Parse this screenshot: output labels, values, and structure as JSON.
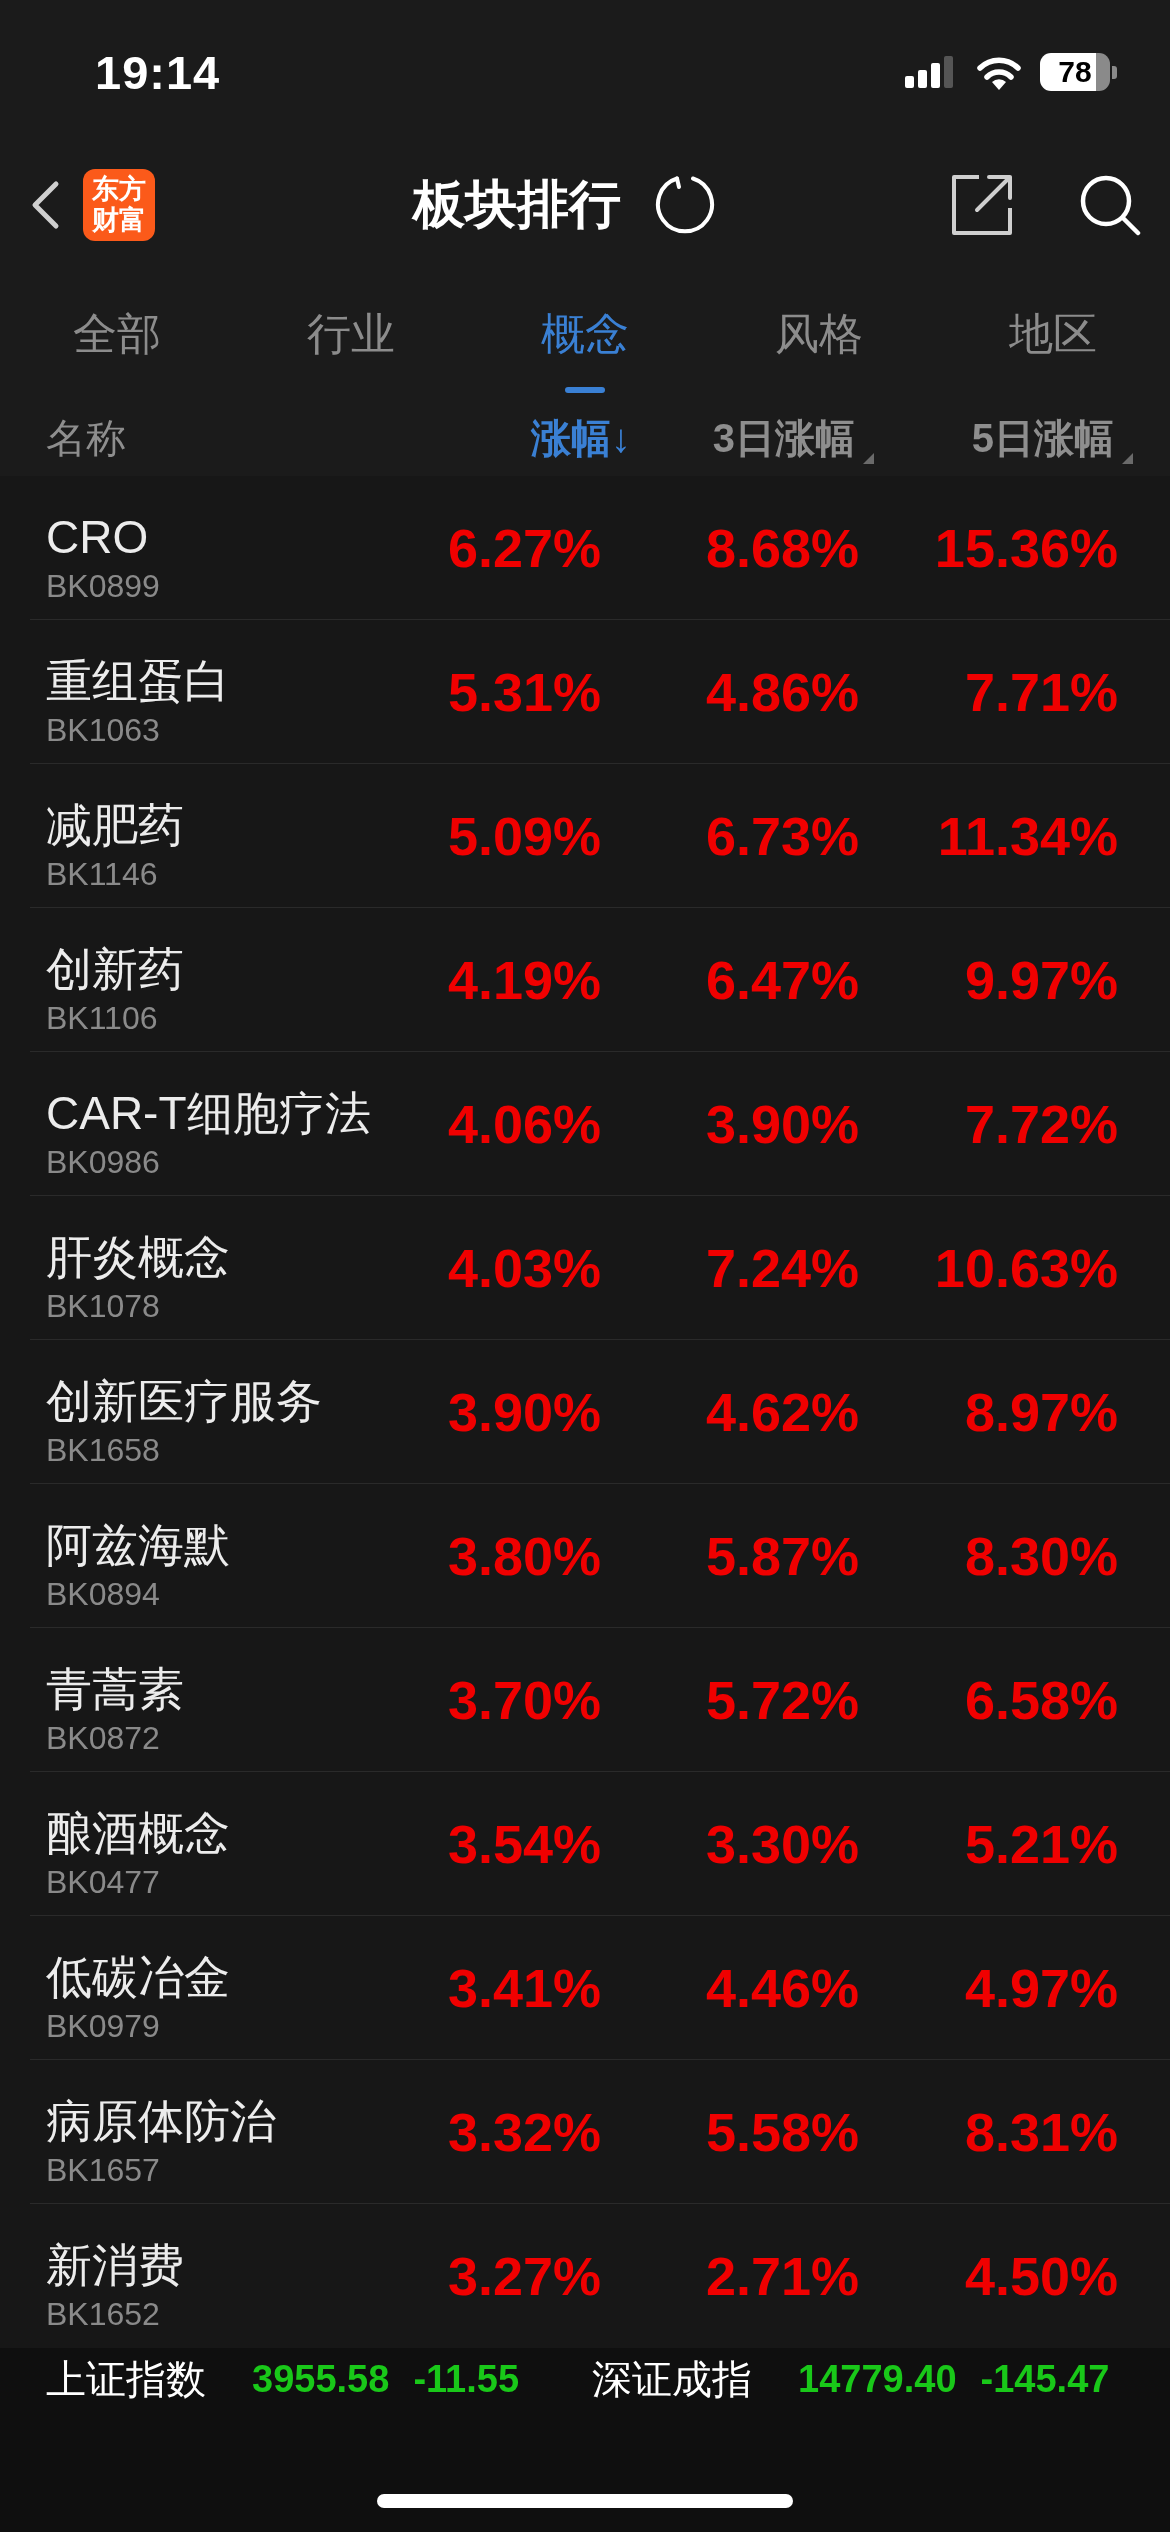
{
  "status_bar": {
    "time": "19:14",
    "battery": "78"
  },
  "header": {
    "logo": [
      "东方",
      "财富"
    ],
    "title": "板块排行"
  },
  "tabs": [
    {
      "label": "全部",
      "selected": false
    },
    {
      "label": "行业",
      "selected": false
    },
    {
      "label": "概念",
      "selected": true
    },
    {
      "label": "风格",
      "selected": false
    },
    {
      "label": "地区",
      "selected": false
    }
  ],
  "table": {
    "name_header": "名称",
    "sort_columns": [
      {
        "label": "涨幅↓",
        "selected": true
      },
      {
        "label": "3日涨幅",
        "selected": false
      },
      {
        "label": "5日涨幅",
        "selected": false
      }
    ],
    "rows": [
      {
        "name": "CRO",
        "code": "BK0899",
        "values": [
          "6.27%",
          "8.68%",
          "15.36%"
        ]
      },
      {
        "name": "重组蛋白",
        "code": "BK1063",
        "values": [
          "5.31%",
          "4.86%",
          "7.71%"
        ]
      },
      {
        "name": "减肥药",
        "code": "BK1146",
        "values": [
          "5.09%",
          "6.73%",
          "11.34%"
        ]
      },
      {
        "name": "创新药",
        "code": "BK1106",
        "values": [
          "4.19%",
          "6.47%",
          "9.97%"
        ]
      },
      {
        "name": "CAR-T细胞疗法",
        "code": "BK0986",
        "values": [
          "4.06%",
          "3.90%",
          "7.72%"
        ]
      },
      {
        "name": "肝炎概念",
        "code": "BK1078",
        "values": [
          "4.03%",
          "7.24%",
          "10.63%"
        ]
      },
      {
        "name": "创新医疗服务",
        "code": "BK1658",
        "values": [
          "3.90%",
          "4.62%",
          "8.97%"
        ]
      },
      {
        "name": "阿兹海默",
        "code": "BK0894",
        "values": [
          "3.80%",
          "5.87%",
          "8.30%"
        ]
      },
      {
        "name": "青蒿素",
        "code": "BK0872",
        "values": [
          "3.70%",
          "5.72%",
          "6.58%"
        ]
      },
      {
        "name": "酿酒概念",
        "code": "BK0477",
        "values": [
          "3.54%",
          "3.30%",
          "5.21%"
        ]
      },
      {
        "name": "低碳冶金",
        "code": "BK0979",
        "values": [
          "3.41%",
          "4.46%",
          "4.97%"
        ]
      },
      {
        "name": "病原体防治",
        "code": "BK1657",
        "values": [
          "3.32%",
          "5.58%",
          "8.31%"
        ]
      },
      {
        "name": "新消费",
        "code": "BK1652",
        "values": [
          "3.27%",
          "2.71%",
          "4.50%"
        ]
      }
    ]
  },
  "index_bar": [
    {
      "name": "上证指数",
      "value": "3955.58",
      "change": "-11.55"
    },
    {
      "name": "深证成指",
      "value": "14779.40",
      "change": "-145.47"
    }
  ]
}
